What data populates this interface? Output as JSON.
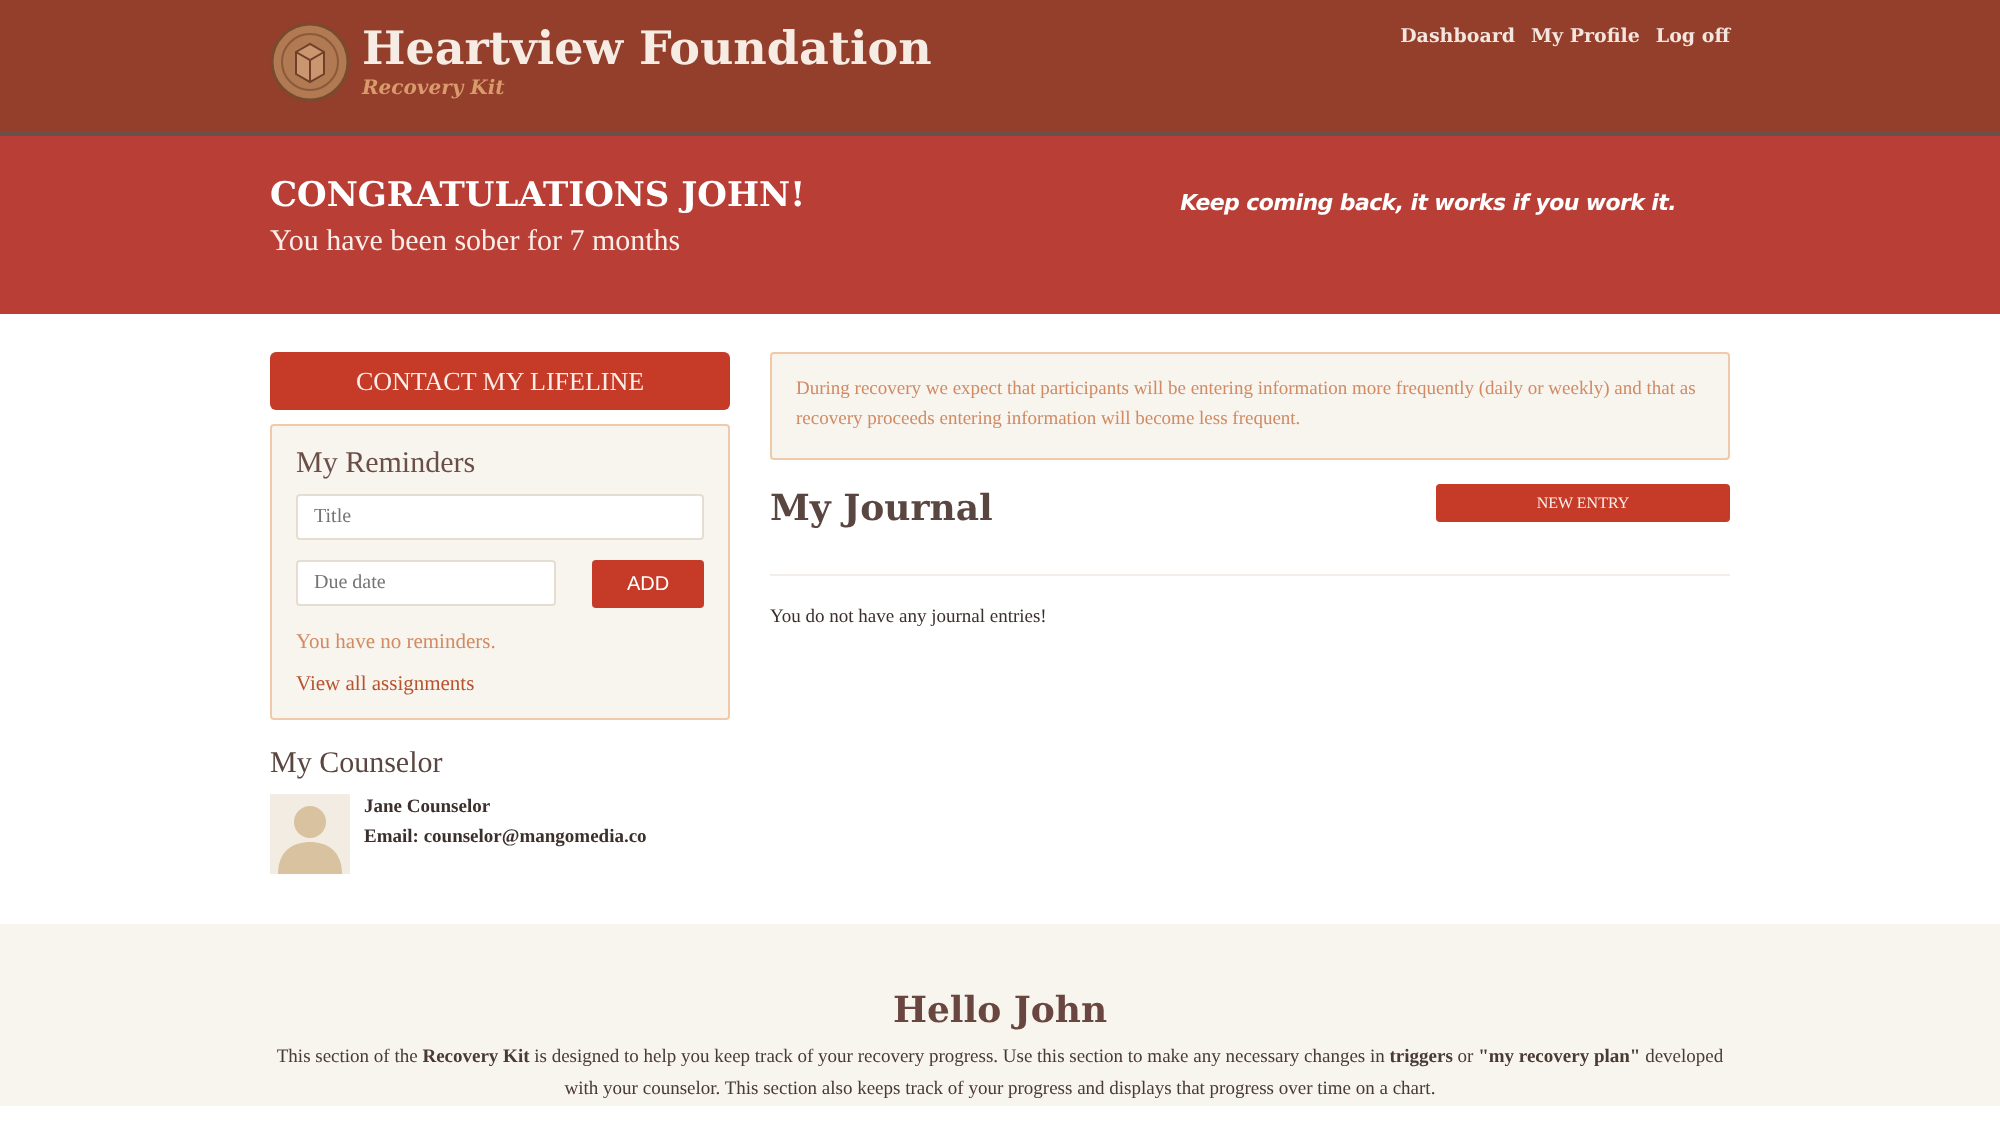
{
  "header": {
    "brand": "Heartview Foundation",
    "tagline": "Recovery Kit",
    "nav": [
      {
        "label": "Dashboard"
      },
      {
        "label": "My Profile"
      },
      {
        "label": "Log off"
      }
    ]
  },
  "banner": {
    "title": "CONGRATULATIONS JOHN!",
    "subtitle": "You have been sober for 7 months",
    "motto": "Keep coming back, it works if you work it."
  },
  "sidebar": {
    "lifeline_button": "CONTACT MY LIFELINE",
    "reminders": {
      "title": "My Reminders",
      "title_field": {
        "placeholder": "Title"
      },
      "date_field": {
        "placeholder": "Due date"
      },
      "add_button": "ADD",
      "empty_text": "You have no reminders.",
      "link": "View all assignments"
    },
    "counselor": {
      "heading": "My Counselor",
      "name": "Jane Counselor",
      "email": "Email: counselor@mangomedia.co"
    }
  },
  "journal": {
    "notice": "During recovery we expect that participants will be entering information more frequently (daily or weekly) and that as recovery proceeds entering information will become less frequent.",
    "title": "My Journal",
    "new_button": "NEW ENTRY",
    "empty_text": "You do not have any journal entries!"
  },
  "footer": {
    "title": "Hello John",
    "text": "This section of the **Recovery Kit** is designed to help you keep track of your recovery progress. Use this section to make any necessary changes in **triggers** or **\"my recovery plan\"** developed with your counselor. This section also keeps track of your progress and displays that progress over time on a chart."
  }
}
